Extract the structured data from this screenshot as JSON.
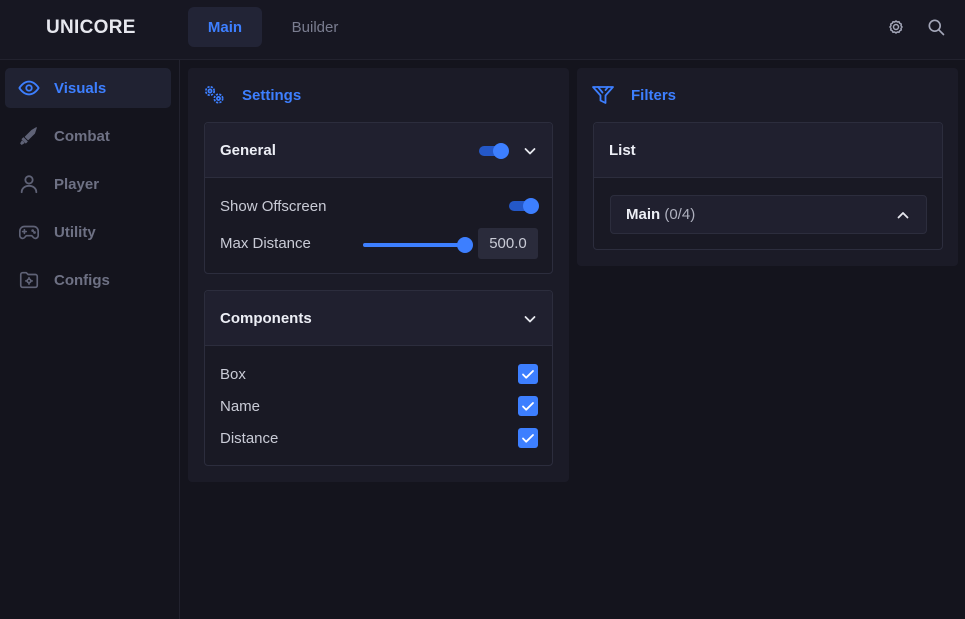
{
  "app": {
    "title": "UNICORE"
  },
  "tabs": [
    {
      "label": "Main",
      "active": true
    },
    {
      "label": "Builder",
      "active": false
    }
  ],
  "topbar_icons": [
    "gear-icon",
    "search-icon"
  ],
  "sidebar": {
    "items": [
      {
        "label": "Visuals",
        "icon": "eye-icon",
        "active": true
      },
      {
        "label": "Combat",
        "icon": "sword-icon",
        "active": false
      },
      {
        "label": "Player",
        "icon": "user-icon",
        "active": false
      },
      {
        "label": "Utility",
        "icon": "gamepad-icon",
        "active": false
      },
      {
        "label": "Configs",
        "icon": "folder-gear-icon",
        "active": false
      }
    ]
  },
  "settings": {
    "title": "Settings",
    "general": {
      "title": "General",
      "enabled": true,
      "show_offscreen": {
        "label": "Show Offscreen",
        "enabled": true
      },
      "max_distance": {
        "label": "Max Distance",
        "value": "500.0",
        "fraction": 1.0
      }
    },
    "components": {
      "title": "Components",
      "items": [
        {
          "label": "Box",
          "checked": true
        },
        {
          "label": "Name",
          "checked": true
        },
        {
          "label": "Distance",
          "checked": true
        }
      ]
    }
  },
  "filters": {
    "title": "Filters",
    "list": {
      "title": "List",
      "select": {
        "name": "Main",
        "count": "(0/4)"
      }
    }
  },
  "colors": {
    "accent": "#3d7fff",
    "background": "#14141d",
    "panel": "#1b1b27"
  }
}
